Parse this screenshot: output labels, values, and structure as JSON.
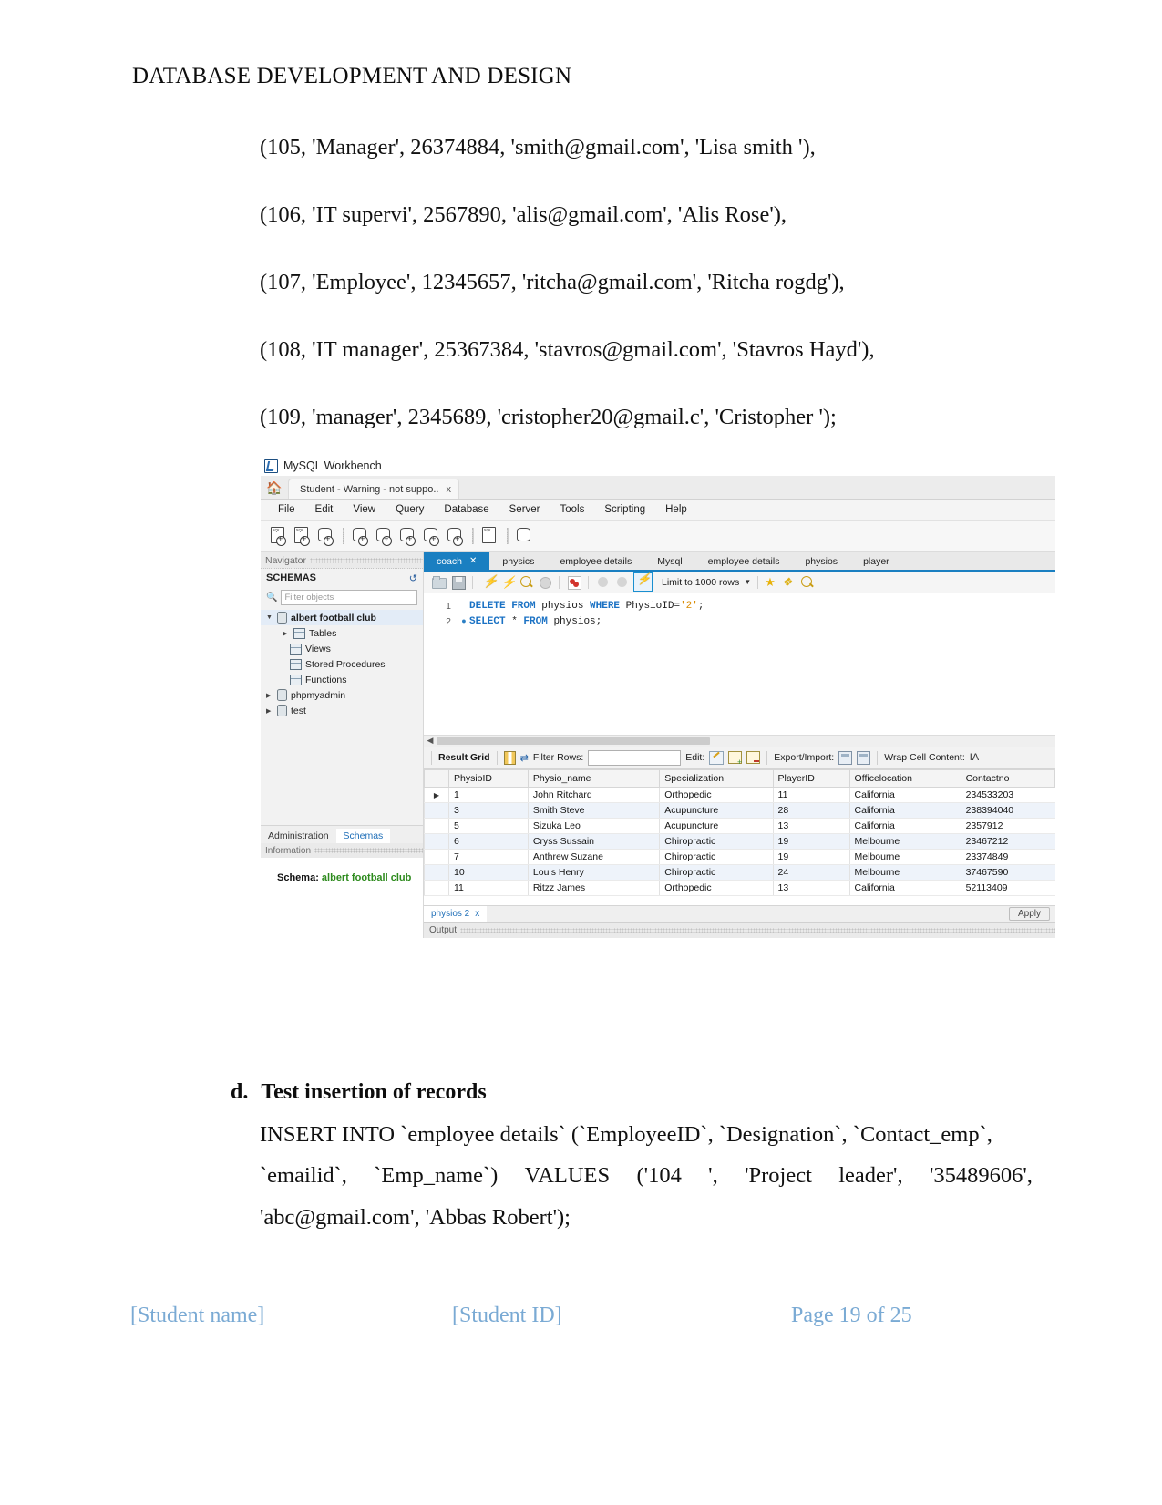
{
  "document": {
    "header": "DATABASE DEVELOPMENT AND DESIGN",
    "insert_rows": [
      "(105, 'Manager', 26374884, 'smith@gmail.com', 'Lisa smith '),",
      "(106, 'IT supervi', 2567890, 'alis@gmail.com', 'Alis Rose'),",
      "(107, 'Employee', 12345657, 'ritcha@gmail.com', 'Ritcha rogdg'),",
      "(108, 'IT manager', 25367384, 'stavros@gmail.com', 'Stavros Hayd'),",
      "(109, 'manager', 2345689, 'cristopher20@gmail.c', 'Cristopher ');"
    ],
    "section": {
      "marker": "d.",
      "title": "Test insertion of records",
      "line1": "INSERT INTO `employee details` (`EmployeeID`, `Designation`, `Contact_emp`,",
      "line2_parts": [
        "`emailid`,",
        "`Emp_name`)",
        "VALUES",
        "('104",
        "',",
        "'Project",
        "leader',",
        "'35489606',"
      ],
      "line3": "'abc@gmail.com', 'Abbas Robert');"
    },
    "footer": {
      "student_name": "[Student name]",
      "student_id": "[Student ID]",
      "page": "Page 19 of 25"
    }
  },
  "workbench": {
    "app_title": "MySQL Workbench",
    "connection_tab": "Student - Warning - not suppo..",
    "connection_tab_close": "x",
    "menu": [
      "File",
      "Edit",
      "View",
      "Query",
      "Database",
      "Server",
      "Tools",
      "Scripting",
      "Help"
    ],
    "navigator": {
      "header": "Navigator",
      "schemas_label": "SCHEMAS",
      "filter_placeholder": "Filter objects",
      "tree": [
        {
          "label": "albert football club",
          "level": 0,
          "expanded": true,
          "selected": true,
          "bold": true
        },
        {
          "label": "Tables",
          "level": 1,
          "expanded": false,
          "selected": false,
          "bold": false
        },
        {
          "label": "Views",
          "level": 1,
          "expanded": null,
          "selected": false,
          "bold": false
        },
        {
          "label": "Stored Procedures",
          "level": 1,
          "expanded": null,
          "selected": false,
          "bold": false
        },
        {
          "label": "Functions",
          "level": 1,
          "expanded": null,
          "selected": false,
          "bold": false
        },
        {
          "label": "phpmyadmin",
          "level": 0,
          "expanded": false,
          "selected": false,
          "bold": false
        },
        {
          "label": "test",
          "level": 0,
          "expanded": false,
          "selected": false,
          "bold": false
        }
      ],
      "bottom_tabs": [
        {
          "label": "Administration",
          "active": false
        },
        {
          "label": "Schemas",
          "active": true
        }
      ],
      "information_header": "Information",
      "schema_label": "Schema:",
      "schema_value": "albert football club"
    },
    "editor": {
      "tabs": [
        {
          "label": "coach",
          "active": true,
          "closable": true
        },
        {
          "label": "physics",
          "active": false,
          "closable": false
        },
        {
          "label": "employee details",
          "active": false,
          "closable": false
        },
        {
          "label": "Mysql",
          "active": false,
          "closable": false
        },
        {
          "label": "employee details",
          "active": false,
          "closable": false
        },
        {
          "label": "physios",
          "active": false,
          "closable": false
        },
        {
          "label": "player",
          "active": false,
          "closable": false
        }
      ],
      "limit_label": "Limit to 1000 rows",
      "code": [
        {
          "num": "1",
          "breakpoint": false,
          "tokens": [
            {
              "t": "DELETE FROM ",
              "c": "kw"
            },
            {
              "t": "physios ",
              "c": "pln"
            },
            {
              "t": "WHERE ",
              "c": "kw"
            },
            {
              "t": "PhysioID=",
              "c": "pln"
            },
            {
              "t": "'2'",
              "c": "str"
            },
            {
              "t": ";",
              "c": "pln"
            }
          ]
        },
        {
          "num": "2",
          "breakpoint": true,
          "tokens": [
            {
              "t": "SELECT ",
              "c": "kw"
            },
            {
              "t": "* ",
              "c": "pln"
            },
            {
              "t": "FROM ",
              "c": "kw"
            },
            {
              "t": "physios;",
              "c": "pln"
            }
          ]
        }
      ]
    },
    "result_grid": {
      "label": "Result Grid",
      "filter_rows_label": "Filter Rows:",
      "filter_rows_value": "",
      "edit_label": "Edit:",
      "export_import_label": "Export/Import:",
      "wrap_label": "Wrap Cell Content:",
      "wrap_icon_glyph": "IA",
      "columns": [
        "",
        "PhysioID",
        "Physio_name",
        "Specialization",
        "PlayerID",
        "Officelocation",
        "Contactno"
      ],
      "rows": [
        {
          "marker": true,
          "cells": [
            "1",
            "John Ritchard",
            "Orthopedic",
            "11",
            "California",
            "234533203"
          ]
        },
        {
          "marker": false,
          "cells": [
            "3",
            "Smith Steve",
            "Acupuncture",
            "28",
            "California",
            "238394040"
          ]
        },
        {
          "marker": false,
          "cells": [
            "5",
            "Sizuka Leo",
            "Acupuncture",
            "13",
            "California",
            "2357912"
          ]
        },
        {
          "marker": false,
          "cells": [
            "6",
            "Cryss Sussain",
            "Chiropractic",
            "19",
            "Melbourne",
            "23467212"
          ]
        },
        {
          "marker": false,
          "cells": [
            "7",
            "Anthrew Suzane",
            "Chiropractic",
            "19",
            "Melbourne",
            "23374849"
          ]
        },
        {
          "marker": false,
          "cells": [
            "10",
            "Louis Henry",
            "Chiropractic",
            "24",
            "Melbourne",
            "37467590"
          ]
        },
        {
          "marker": false,
          "cells": [
            "11",
            "Ritzz James",
            "Orthopedic",
            "13",
            "California",
            "52113409"
          ]
        }
      ],
      "result_tab": "physios 2",
      "result_tab_close": "x",
      "apply_label": "Apply"
    },
    "output_label": "Output"
  }
}
